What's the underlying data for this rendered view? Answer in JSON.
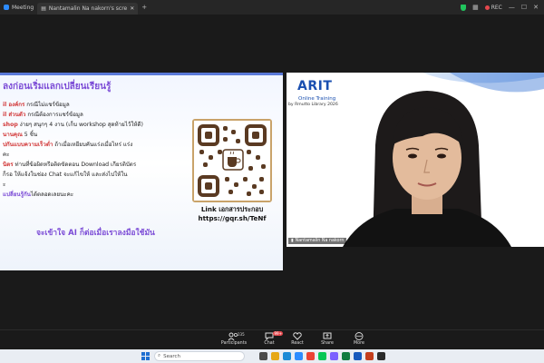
{
  "titlebar": {
    "app": "Meeting",
    "tab_label": "Nantamalin Na nakorn's scre",
    "rec_label": "REC",
    "colors": {
      "shield": "#21c55d",
      "rec": "#e5484d"
    }
  },
  "slide": {
    "title": "ลงก่อนเริ่มแลกเปลี่ยนเรียนรู้",
    "lines": [
      {
        "hl": "il องค์กร",
        "text": " กรณีไม่แชร์ข้อมูล"
      },
      {
        "hl": "il ส่วนตัว",
        "text": " กรณีต้องการแชร์ข้อมูล"
      },
      {
        "hl": "shop",
        "text": " ง่ายๆ สนุกๆ  4 งาน (เก็บ workshop สุดท้ายไว้ให้ดี)"
      },
      {
        "hl": "นานคุณ",
        "text": " 5 ชิ้น"
      },
      {
        "hl": "ปกันแบบความเร็วต่ำ",
        "text": "  ถ้าเมื่อเหยียบคันแร่งเมื่อไหร่ แร่ง"
      },
      {
        "hl": "",
        "text": "คะ"
      },
      {
        "hl": "นิตร",
        "text": "  ท่านที่ข้อผิดหรือติดขัดตอน Download เกียรติบัตร"
      },
      {
        "hl": "",
        "text": "ก็รอ ให้แจ้งในช่อง Chat จะแก้ไขให้ และส่งไปให้ใน"
      },
      {
        "hl": "",
        "text": "ะ"
      },
      {
        "hl2": "แปลี่ยนรู้กัน",
        "text": "ได้ตลอดเลยนะคะ"
      }
    ],
    "footer": "จะเข้าใจ AI ก็ต่อเมื่อเราลงมือใช้มัน",
    "qr_link_label": "Link เอกสารประกอบ",
    "qr_link_url": "https://gqr.sh/TeNf"
  },
  "video": {
    "logo": "ARIT",
    "subtitle": "Online Training",
    "subtitle2": "by Rmutto Library 2026",
    "name": "Nantamalin Na nakorn"
  },
  "toolbar": {
    "items": [
      {
        "label": "Participants",
        "count": "235"
      },
      {
        "label": "Chat",
        "badge": "99+"
      },
      {
        "label": "React"
      },
      {
        "label": "Share"
      },
      {
        "label": "More"
      }
    ]
  },
  "taskbar": {
    "search_placeholder": "Search"
  }
}
